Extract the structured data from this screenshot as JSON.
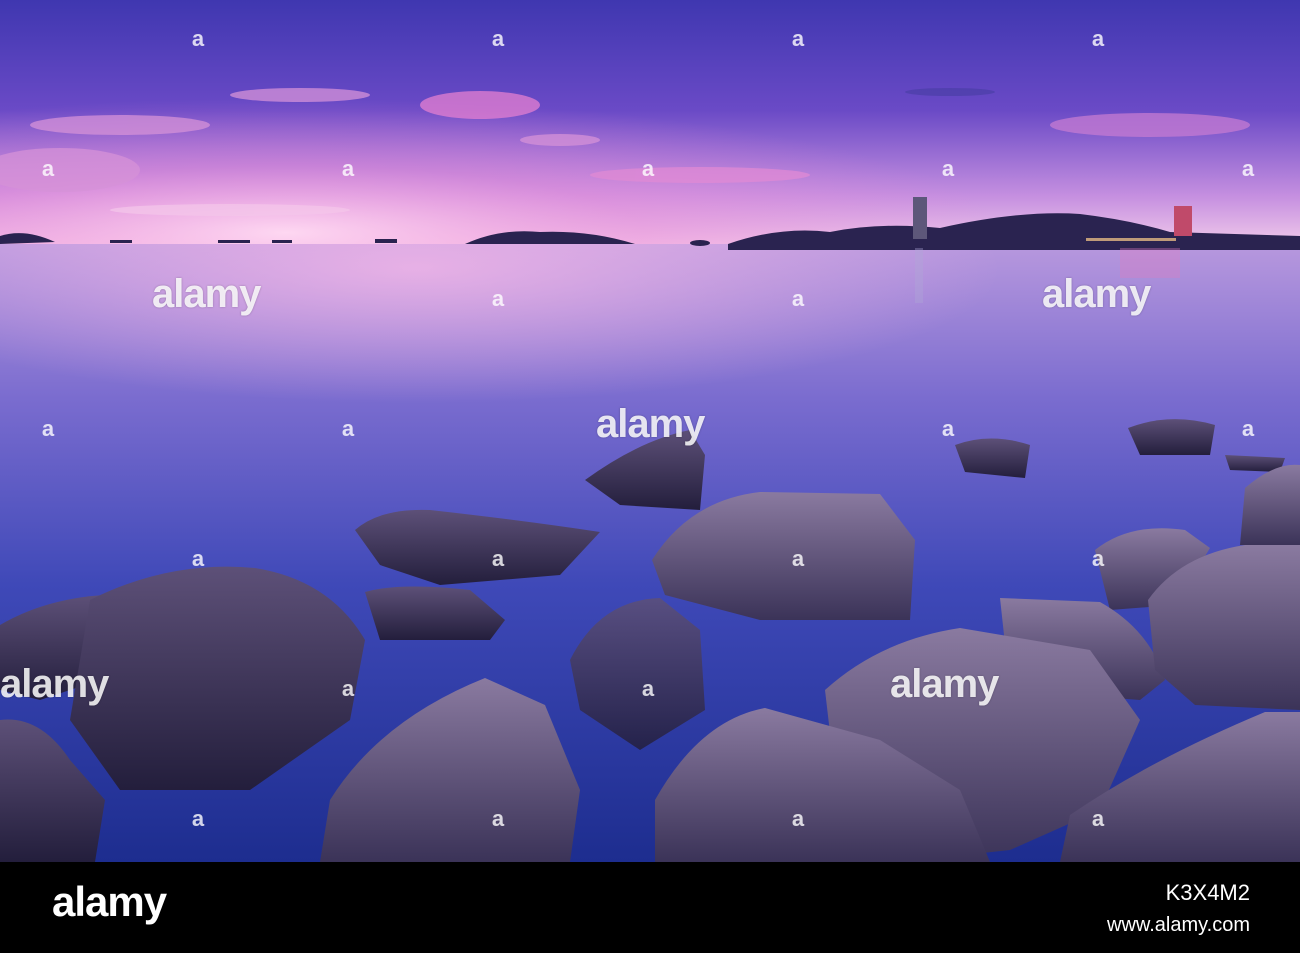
{
  "watermark": {
    "brand": "alamy",
    "mark": "a"
  },
  "footer": {
    "brand": "alamy",
    "image_id": "K3X4M2",
    "url": "www.alamy.com"
  },
  "colors": {
    "sky_top": "#4a3fb5",
    "sky_horizon": "#e8b8e0",
    "water": "#2e3aa8",
    "rock": "#5a4d7a",
    "footer_bg": "#000000"
  }
}
